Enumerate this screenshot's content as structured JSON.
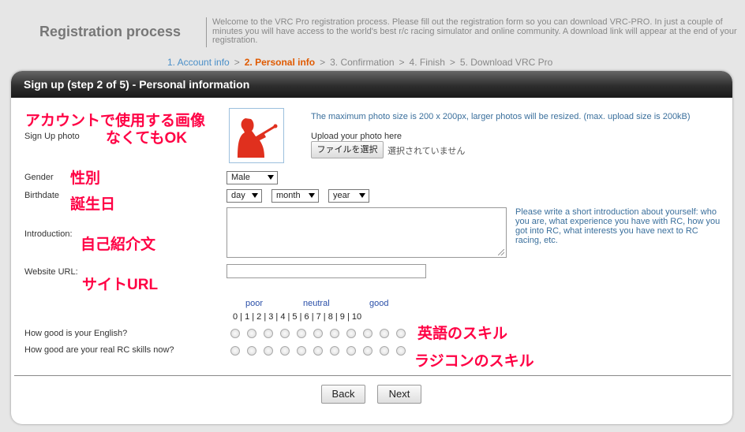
{
  "header": {
    "title": "Registration process",
    "welcome": "Welcome to the VRC Pro registration process. Please fill out the registration form so you can download VRC-PRO. In just a couple of minutes you will have access to the world's best r/c racing simulator and online community. A download link will appear at the end of your registration."
  },
  "steps": {
    "items": [
      "1. Account info",
      "2. Personal info",
      "3. Confirmation",
      "4. Finish",
      "5. Download VRC Pro"
    ],
    "separator": ">",
    "active": "2. Personal info"
  },
  "card": {
    "title": "Sign up (step 2 of 5) - Personal information"
  },
  "photo": {
    "label": "Sign Up photo",
    "info": "The maximum photo size is 200 x 200px, larger photos will be resized. (max. upload size is 200kB)",
    "upload_label": "Upload your photo here",
    "choose_button": "ファイルを選択",
    "file_status": "選択されていません",
    "annotation_line1": "アカウントで使用する画像",
    "annotation_line2": "なくてもOK"
  },
  "gender": {
    "label": "Gender",
    "value": "Male",
    "annotation": "性別"
  },
  "birthdate": {
    "label": "Birthdate",
    "day": "day",
    "month": "month",
    "year": "year",
    "annotation": "誕生日"
  },
  "introduction": {
    "label": "Introduction:",
    "hint": "Please write a short introduction about yourself: who you are, what experience you have with RC, how you got into RC, what interests you have next to RC racing, etc.",
    "annotation": "自己紹介文"
  },
  "website": {
    "label": "Website URL:",
    "annotation": "サイトURL"
  },
  "skills": {
    "poor": "poor",
    "neutral": "neutral",
    "good": "good",
    "numbers": "0 | 1 | 2 | 3 | 4 | 5 | 6 | 7 | 8 | 9 | 10",
    "english_label": "How good is your English?",
    "english_annotation": "英語のスキル",
    "rc_label": "How good are your real RC skills now?",
    "rc_annotation": "ラジコンのスキル"
  },
  "buttons": {
    "back": "Back",
    "next": "Next"
  },
  "colors": {
    "active_step": "#e05a00",
    "done_step": "#4a8fc8",
    "annotation": "#ff0044",
    "header_bar": "#2e2e2e"
  }
}
